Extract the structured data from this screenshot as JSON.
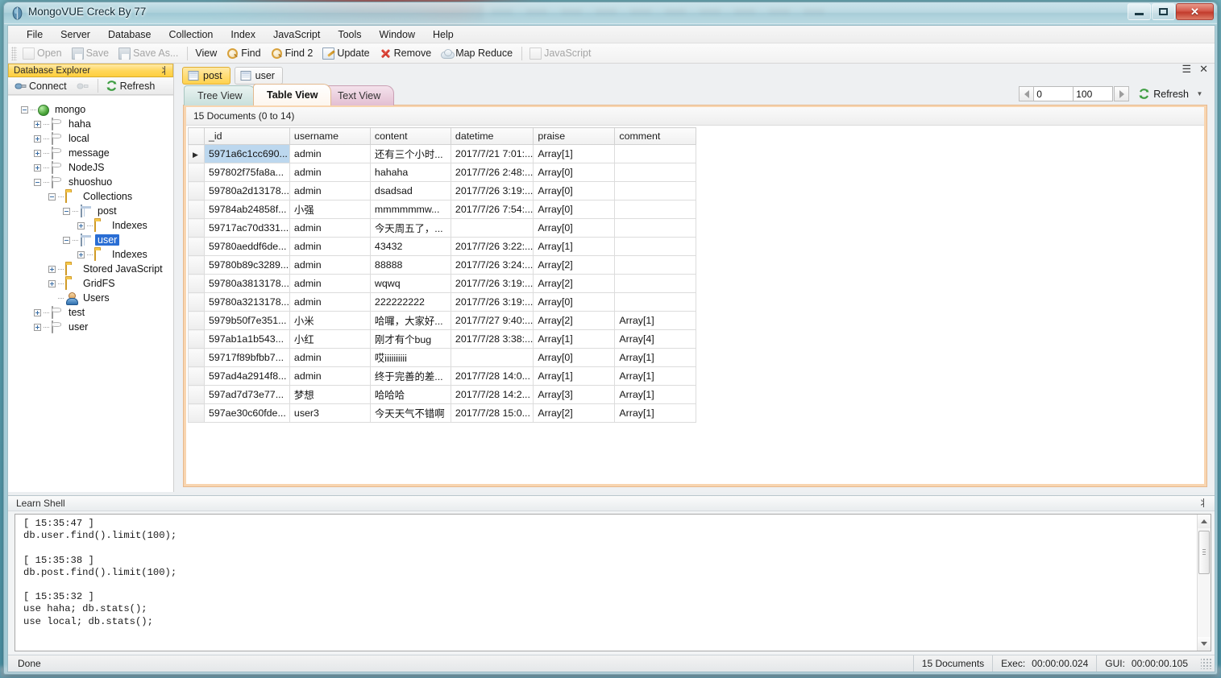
{
  "window": {
    "title": "MongoVUE Creck By 77",
    "icon": "mongo-leaf-icon",
    "minimize_label": "Minimize",
    "maximize_label": "Maximize",
    "close_label": "Close"
  },
  "menubar": {
    "items": [
      {
        "label": "File"
      },
      {
        "label": "Server"
      },
      {
        "label": "Database"
      },
      {
        "label": "Collection"
      },
      {
        "label": "Index"
      },
      {
        "label": "JavaScript"
      },
      {
        "label": "Tools"
      },
      {
        "label": "Window"
      },
      {
        "label": "Help"
      }
    ]
  },
  "toolbar": {
    "items": [
      {
        "label": "Open",
        "icon": "open-document-icon",
        "disabled": true
      },
      {
        "label": "Save",
        "icon": "save-icon",
        "disabled": true
      },
      {
        "label": "Save As...",
        "icon": "save-as-icon",
        "disabled": true
      },
      {
        "label": "View",
        "icon": "none",
        "disabled": false
      },
      {
        "label": "Find",
        "icon": "magnifier-icon",
        "disabled": false
      },
      {
        "label": "Find 2",
        "icon": "magnifier-icon",
        "disabled": false
      },
      {
        "label": "Update",
        "icon": "update-pencil-icon",
        "disabled": false
      },
      {
        "label": "Remove",
        "icon": "red-x-icon",
        "disabled": false
      },
      {
        "label": "Map Reduce",
        "icon": "cloud-icon",
        "disabled": false
      },
      {
        "label": "JavaScript",
        "icon": "javascript-page-icon",
        "disabled": true
      }
    ]
  },
  "explorer": {
    "caption": "Database Explorer",
    "pin_glyph": "丬",
    "connect_label": "Connect",
    "disconnect_label": "Disconnect",
    "refresh_label": "Refresh",
    "tree": [
      {
        "label": "mongo",
        "icon": "globe-icon",
        "indent": 0,
        "expander": "minus"
      },
      {
        "label": "haha",
        "icon": "database-icon",
        "indent": 1,
        "expander": "plus"
      },
      {
        "label": "local",
        "icon": "database-icon",
        "indent": 1,
        "expander": "plus"
      },
      {
        "label": "message",
        "icon": "database-icon",
        "indent": 1,
        "expander": "plus"
      },
      {
        "label": "NodeJS",
        "icon": "database-icon",
        "indent": 1,
        "expander": "plus"
      },
      {
        "label": "shuoshuo",
        "icon": "database-icon",
        "indent": 1,
        "expander": "minus"
      },
      {
        "label": "Collections",
        "icon": "folder-icon",
        "indent": 2,
        "expander": "minus"
      },
      {
        "label": "post",
        "icon": "collection-icon",
        "indent": 3,
        "expander": "minus"
      },
      {
        "label": "Indexes",
        "icon": "folder-icon",
        "indent": 4,
        "expander": "plus"
      },
      {
        "label": "user",
        "icon": "collection-icon",
        "indent": 3,
        "expander": "minus",
        "selected": true
      },
      {
        "label": "Indexes",
        "icon": "folder-icon",
        "indent": 4,
        "expander": "plus"
      },
      {
        "label": "Stored JavaScript",
        "icon": "folder-icon",
        "indent": 2,
        "expander": "plus"
      },
      {
        "label": "GridFS",
        "icon": "folder-icon",
        "indent": 2,
        "expander": "plus"
      },
      {
        "label": "Users",
        "icon": "users-icon",
        "indent": 2,
        "expander": "none"
      },
      {
        "label": "test",
        "icon": "database-icon",
        "indent": 1,
        "expander": "plus"
      },
      {
        "label": "user",
        "icon": "database-icon",
        "indent": 1,
        "expander": "plus"
      }
    ]
  },
  "document_tabs": [
    {
      "label": "post",
      "icon": "collection-icon",
      "active": true
    },
    {
      "label": "user",
      "icon": "collection-icon",
      "active": false
    }
  ],
  "tab_controls": {
    "menu_glyph": "☰",
    "close_glyph": "✕"
  },
  "view_tabs": [
    {
      "label": "Tree View",
      "active": false
    },
    {
      "label": "Table View",
      "active": true
    },
    {
      "label": "Text View",
      "active": false
    }
  ],
  "pager": {
    "prev_label": "Previous page",
    "next_label": "Next page",
    "skip_value": "0",
    "limit_value": "100",
    "refresh_label": "Refresh",
    "dropdown_glyph": "▼"
  },
  "result": {
    "summary": "15 Documents (0 to 14)",
    "columns": [
      "_id",
      "username",
      "content",
      "datetime",
      "praise",
      "comment"
    ],
    "rows": [
      {
        "selected": true,
        "current": true,
        "_id": "5971a6c1cc690...",
        "username": "admin",
        "content": "还有三个小时...",
        "datetime": "2017/7/21 7:01:...",
        "praise": "Array[1]",
        "comment": ""
      },
      {
        "selected": false,
        "current": false,
        "_id": "597802f75fa8a...",
        "username": "admin",
        "content": "hahaha",
        "datetime": "2017/7/26 2:48:...",
        "praise": "Array[0]",
        "comment": ""
      },
      {
        "selected": false,
        "current": false,
        "_id": "59780a2d13178...",
        "username": "admin",
        "content": "dsadsad",
        "datetime": "2017/7/26 3:19:...",
        "praise": "Array[0]",
        "comment": ""
      },
      {
        "selected": false,
        "current": false,
        "_id": "59784ab24858f...",
        "username": "小强",
        "content": "mmmmmmw...",
        "datetime": "2017/7/26 7:54:...",
        "praise": "Array[0]",
        "comment": ""
      },
      {
        "selected": false,
        "current": false,
        "_id": "59717ac70d331...",
        "username": "admin",
        "content": "今天周五了，...",
        "datetime": "",
        "praise": "Array[0]",
        "comment": ""
      },
      {
        "selected": false,
        "current": false,
        "_id": "59780aeddf6de...",
        "username": "admin",
        "content": "43432",
        "datetime": "2017/7/26 3:22:...",
        "praise": "Array[1]",
        "comment": ""
      },
      {
        "selected": false,
        "current": false,
        "_id": "59780b89c3289...",
        "username": "admin",
        "content": "88888",
        "datetime": "2017/7/26 3:24:...",
        "praise": "Array[2]",
        "comment": ""
      },
      {
        "selected": false,
        "current": false,
        "_id": "59780a3813178...",
        "username": "admin",
        "content": "wqwq",
        "datetime": "2017/7/26 3:19:...",
        "praise": "Array[2]",
        "comment": ""
      },
      {
        "selected": false,
        "current": false,
        "_id": "59780a3213178...",
        "username": "admin",
        "content": "222222222",
        "datetime": "2017/7/26 3:19:...",
        "praise": "Array[0]",
        "comment": ""
      },
      {
        "selected": false,
        "current": false,
        "_id": "5979b50f7e351...",
        "username": "小米",
        "content": "哈囉，大家好...",
        "datetime": "2017/7/27 9:40:...",
        "praise": "Array[2]",
        "comment": "Array[1]"
      },
      {
        "selected": false,
        "current": false,
        "_id": "597ab1a1b543...",
        "username": "小红",
        "content": "刚才有个bug",
        "datetime": "2017/7/28 3:38:...",
        "praise": "Array[1]",
        "comment": "Array[4]"
      },
      {
        "selected": false,
        "current": false,
        "_id": "59717f89bfbb7...",
        "username": "admin",
        "content": "哎iiiiiiiiii",
        "datetime": "",
        "praise": "Array[0]",
        "comment": "Array[1]"
      },
      {
        "selected": false,
        "current": false,
        "_id": "597ad4a2914f8...",
        "username": "admin",
        "content": "终于完善的差...",
        "datetime": "2017/7/28 14:0...",
        "praise": "Array[1]",
        "comment": "Array[1]"
      },
      {
        "selected": false,
        "current": false,
        "_id": "597ad7d73e77...",
        "username": "梦想",
        "content": "哈哈哈",
        "datetime": "2017/7/28 14:2...",
        "praise": "Array[3]",
        "comment": "Array[1]"
      },
      {
        "selected": false,
        "current": false,
        "_id": "597ae30c60fde...",
        "username": "user3",
        "content": "今天天气不错啊",
        "datetime": "2017/7/28 15:0...",
        "praise": "Array[2]",
        "comment": "Array[1]"
      }
    ]
  },
  "shell": {
    "caption": "Learn Shell",
    "pin_glyph": "丬",
    "log": "[ 15:35:47 ]\ndb.user.find().limit(100);\n\n[ 15:35:38 ]\ndb.post.find().limit(100);\n\n[ 15:35:32 ]\nuse haha; db.stats();\nuse local; db.stats();"
  },
  "statusbar": {
    "message": "Done",
    "documents": "15 Documents",
    "exec_label": "Exec:",
    "exec_value": "00:00:00.024",
    "gui_label": "GUI:",
    "gui_value": "00:00:00.105"
  },
  "colors": {
    "accent_yellow": "#ffd24d",
    "table_tab_border": "#f8d5b0",
    "selection_blue": "#2a6ed4",
    "cell_selection": "#bcd7ee"
  }
}
